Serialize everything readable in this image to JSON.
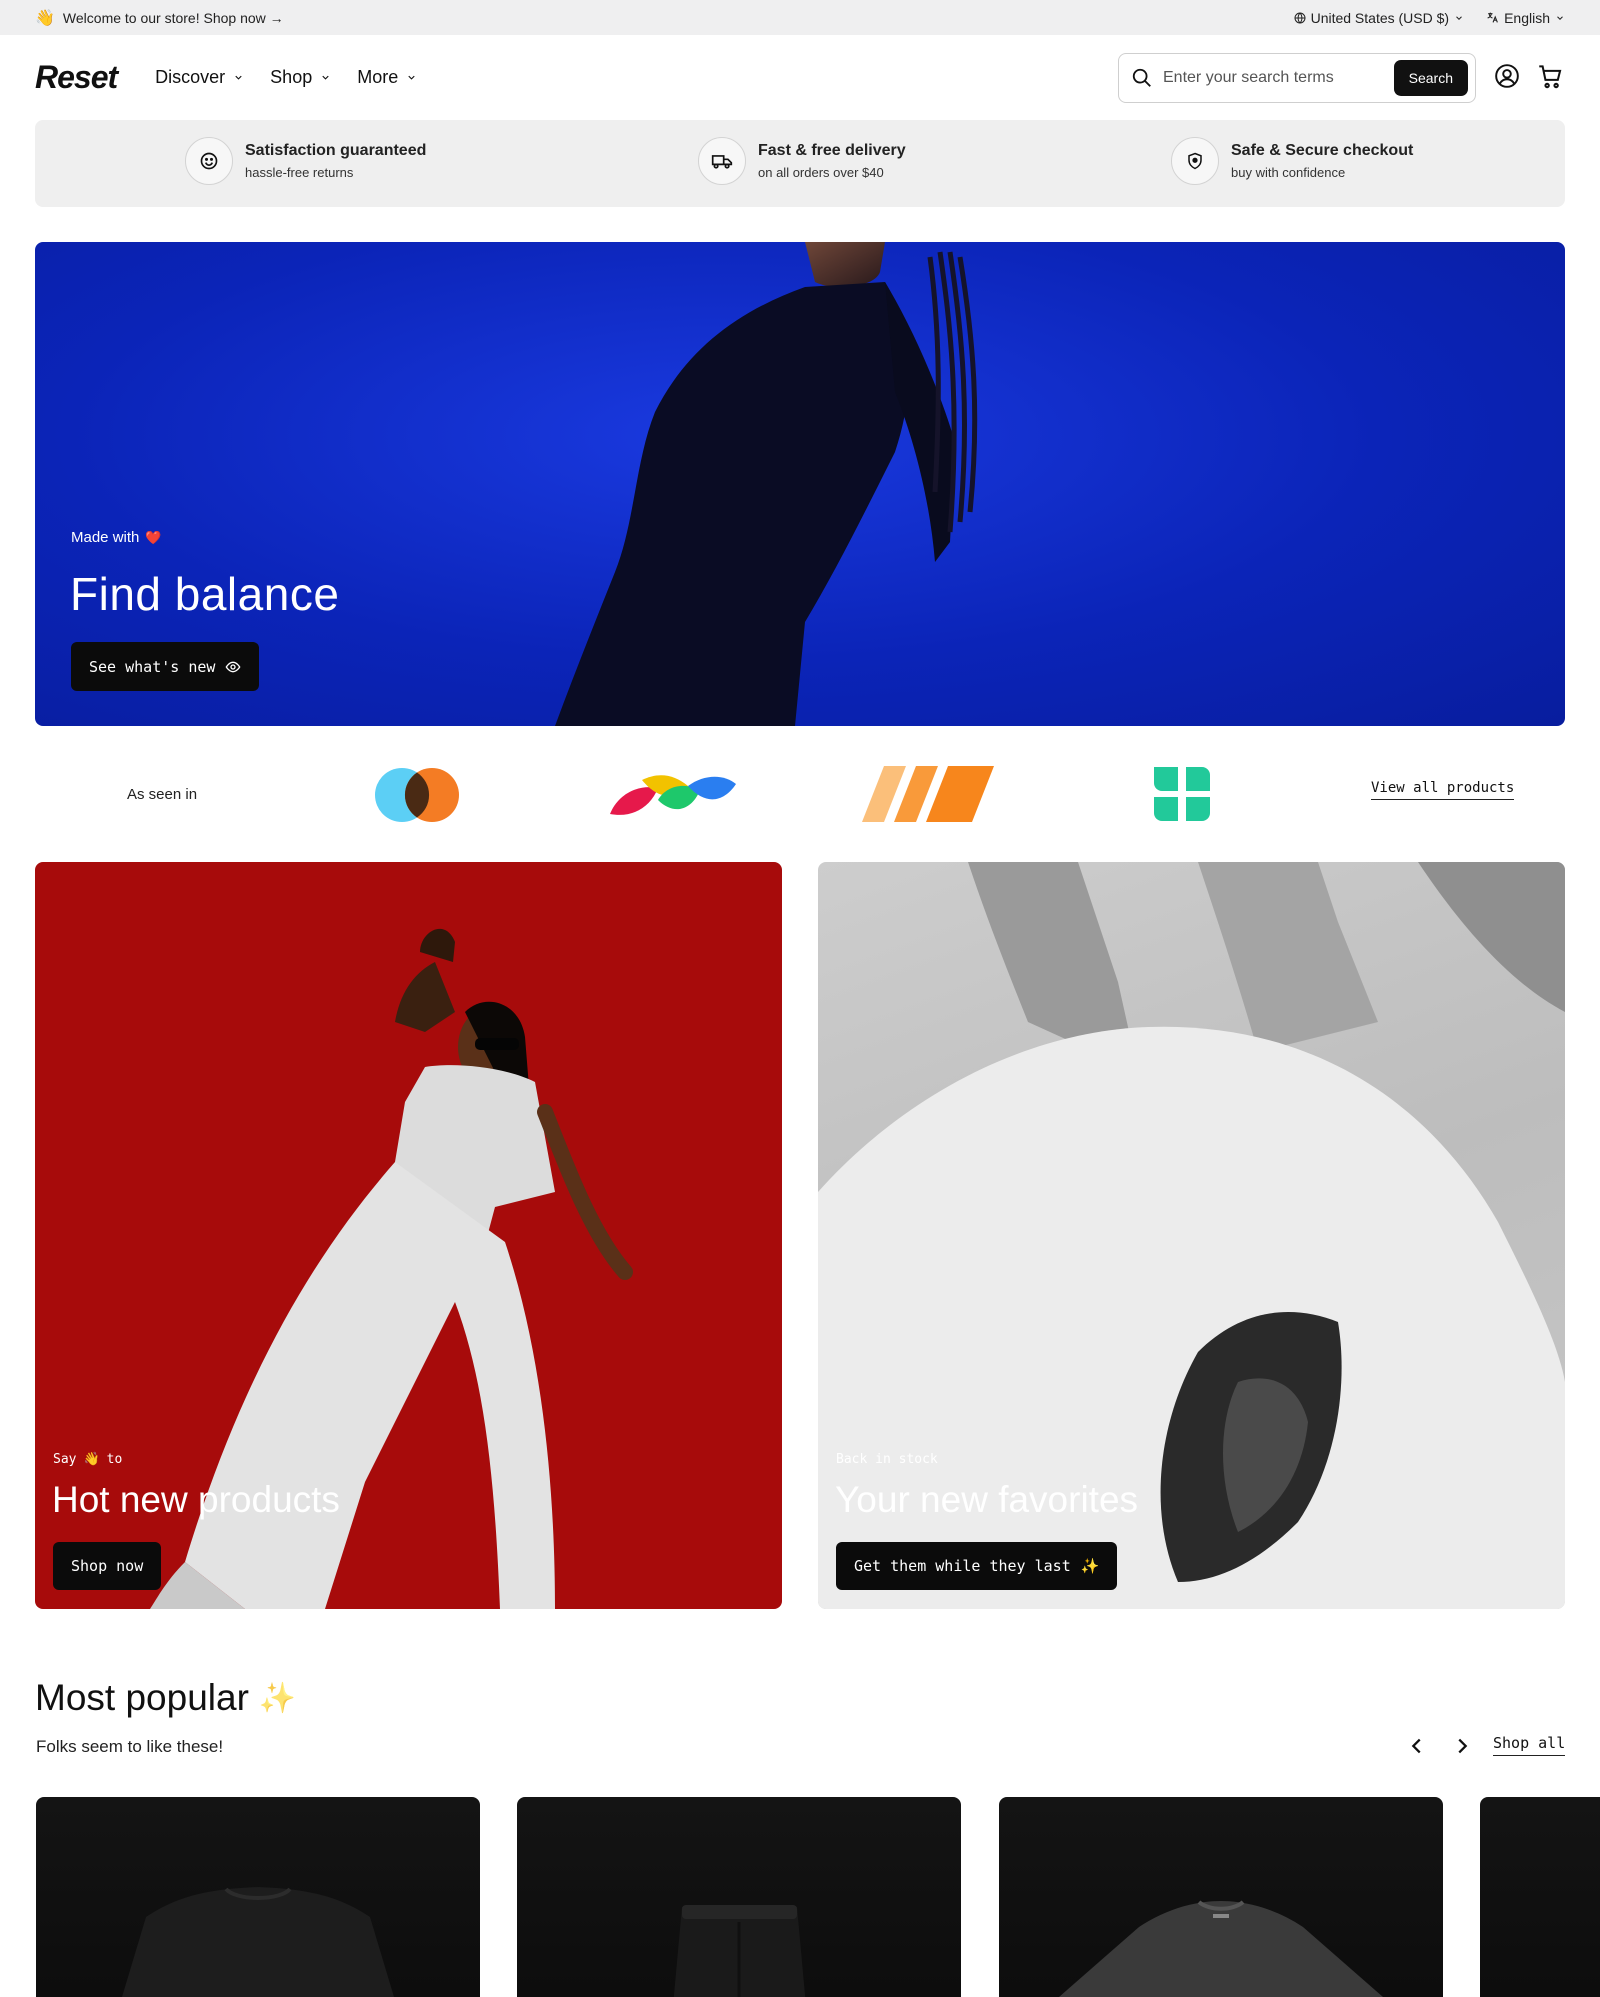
{
  "announcement": {
    "emoji": "👋",
    "text": "Welcome to our store! Shop now →",
    "country": "United States (USD $)",
    "language": "English"
  },
  "header": {
    "logo": "Reset",
    "nav": [
      {
        "label": "Discover"
      },
      {
        "label": "Shop"
      },
      {
        "label": "More"
      }
    ],
    "search": {
      "placeholder": "Enter your search terms",
      "button": "Search"
    }
  },
  "features": [
    {
      "icon": "smile-icon",
      "title": "Satisfaction guaranteed",
      "subtitle": "hassle-free returns"
    },
    {
      "icon": "truck-icon",
      "title": "Fast & free delivery",
      "subtitle": "on all orders over $40"
    },
    {
      "icon": "shield-icon",
      "title": "Safe & Secure checkout",
      "subtitle": "buy with confidence"
    }
  ],
  "hero": {
    "kicker": "Made with",
    "kicker_emoji": "❤️",
    "title": "Find balance",
    "button": "See what's new"
  },
  "as_seen_in": {
    "label": "As seen in",
    "link": "View all products"
  },
  "promos": [
    {
      "kicker_pre": "Say",
      "kicker_emoji": "👋",
      "kicker_post": "to",
      "title": "Hot new products",
      "button": "Shop now"
    },
    {
      "kicker": "Back in stock",
      "title": "Your new favorites",
      "button": "Get them while they last",
      "button_emoji": "✨"
    }
  ],
  "most_popular": {
    "title": "Most popular",
    "emoji": "✨",
    "subtitle": "Folks seem to like these!",
    "shop_all": "Shop all"
  },
  "colors": {
    "hero_blue": "#0b24b8",
    "promo_red": "#a70b0b",
    "button_dark": "#0b0b0b",
    "feature_bg": "#efefef"
  }
}
